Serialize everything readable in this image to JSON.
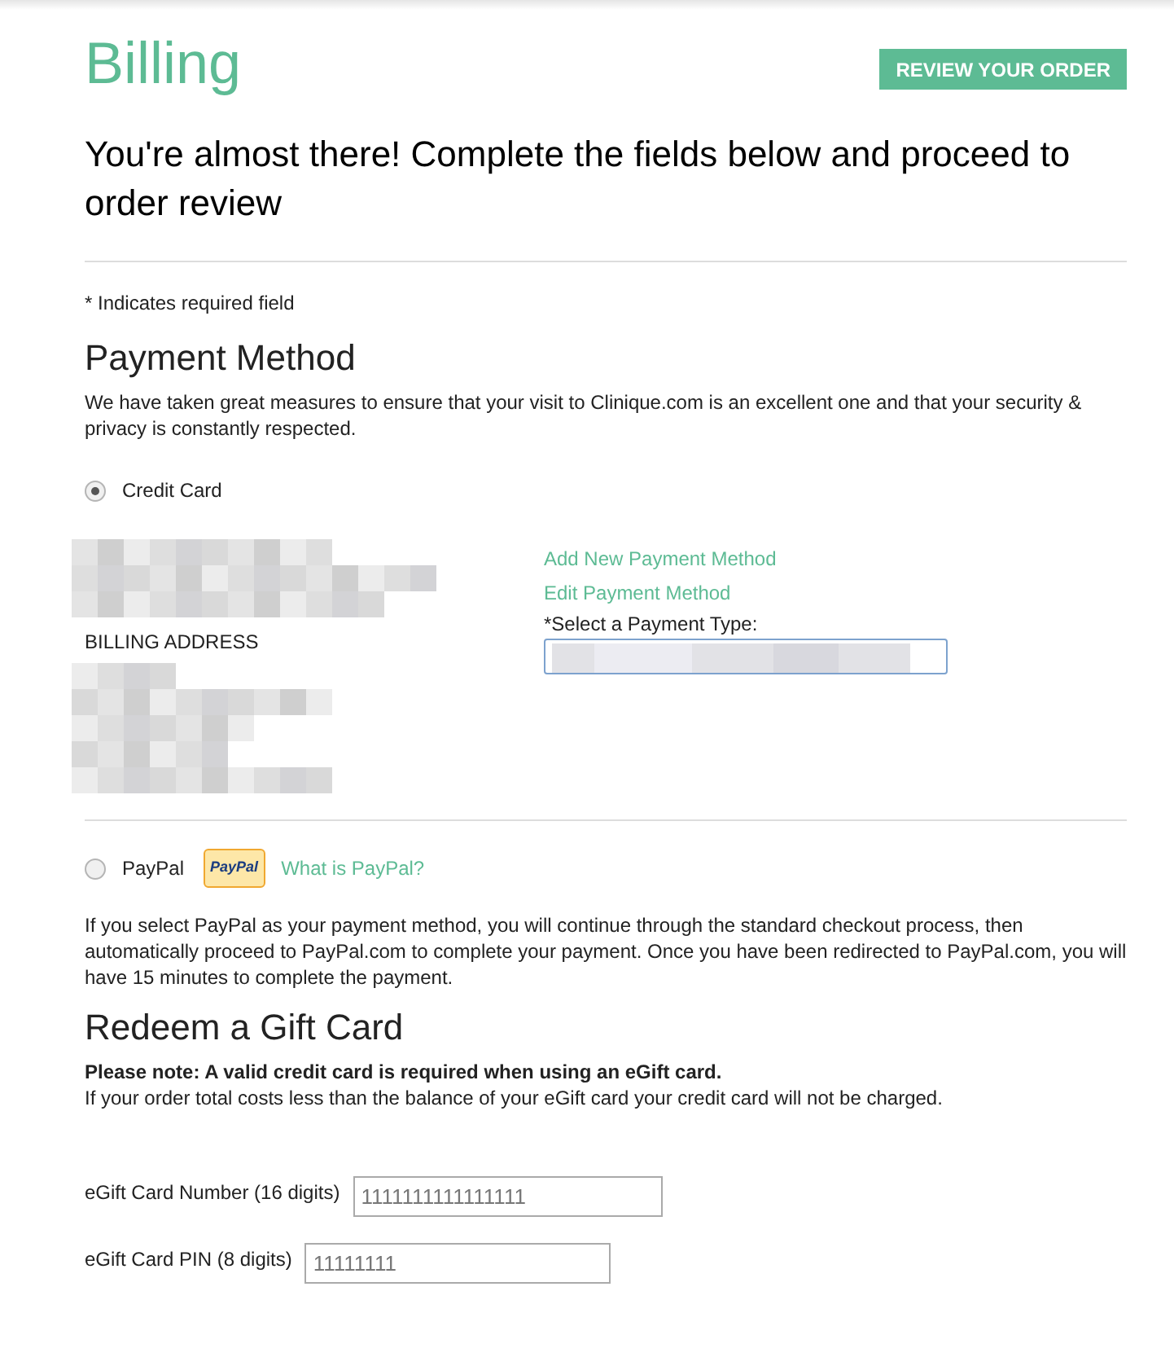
{
  "title": "Billing",
  "review_button": "REVIEW YOUR ORDER",
  "subtitle": "You're almost there! Complete the fields below and proceed to order review",
  "required_note": "* Indicates required field",
  "payment_method": {
    "heading": "Payment Method",
    "intro": "We have taken great measures to ensure that your visit to Clinique.com is an excellent one and that your security & privacy is constantly respected.",
    "options": [
      {
        "kind": "card",
        "label": "Credit Card",
        "selected": true
      },
      {
        "kind": "paypal",
        "label": "PayPal",
        "selected": false,
        "logo": "PayPal",
        "link": "What is PayPal?"
      }
    ],
    "card": {
      "billing_address_label": "BILLING ADDRESS",
      "links": [
        "Add New Payment Method",
        "Edit Payment Method"
      ],
      "select_label": "*Select a Payment Type:"
    },
    "paypal_note": "If you select PayPal as your payment method, you will continue through the standard checkout process, then automatically proceed to PayPal.com to complete your payment. Once you have been redirected to PayPal.com, you will have 15 minutes to complete the payment."
  },
  "gift_card": {
    "heading": "Redeem a Gift Card",
    "note": "**Please note: A valid credit card is required when using an eGift card.**",
    "note2": "If your order total costs less than the balance of your eGift card your credit card will not be charged.",
    "fields": [
      {
        "label": "eGift Card Number (16 digits)",
        "placeholder": "1111111111111111"
      },
      {
        "label": "eGift Card PIN (8 digits)",
        "placeholder": "11111111"
      }
    ]
  }
}
